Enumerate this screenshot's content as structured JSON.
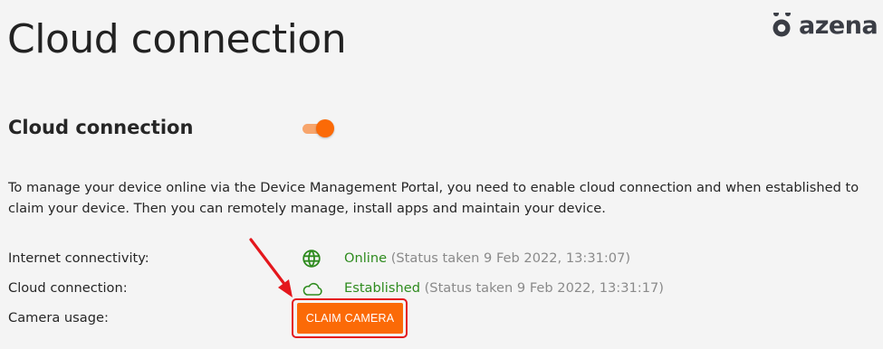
{
  "page": {
    "title": "Cloud connection"
  },
  "brand": {
    "name": "azena",
    "icon": "azena-logo-icon",
    "color": "#3a3d45"
  },
  "section": {
    "heading": "Cloud connection",
    "toggle": {
      "on": true,
      "color": "#fb6a07"
    },
    "description": "To manage your device online via the Device Management Portal, you need to enable cloud connection and when established to claim your device. Then you can remotely manage, install apps and maintain your device."
  },
  "status": {
    "internet": {
      "label": "Internet connectivity:",
      "icon": "globe-icon",
      "value": "Online",
      "time": "(Status taken 9 Feb 2022, 13:31:07)"
    },
    "cloud": {
      "label": "Cloud connection:",
      "icon": "cloud-icon",
      "value": "Established",
      "time": "(Status taken 9 Feb 2022, 13:31:17)"
    },
    "camera": {
      "label": "Camera usage:",
      "button": "CLAIM CAMERA"
    }
  },
  "colors": {
    "accent": "#fb6a07",
    "success": "#2e8b1e",
    "muted": "#8a8a8a",
    "annotation": "#e4171d"
  }
}
